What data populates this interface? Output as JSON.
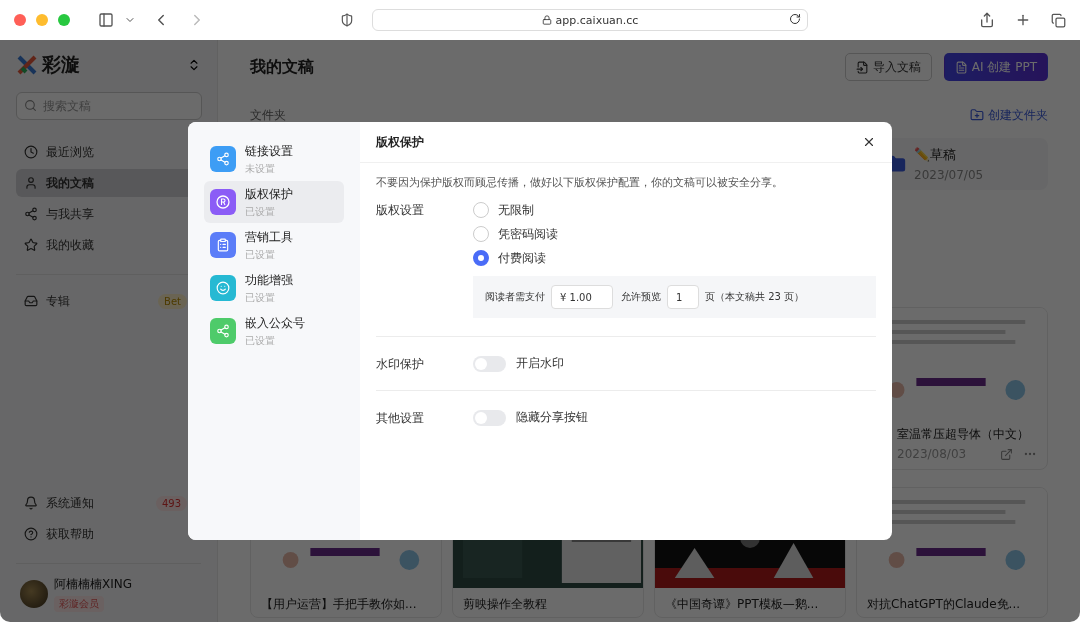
{
  "browser": {
    "url": "app.caixuan.cc"
  },
  "sidebar": {
    "brand": "彩漩",
    "search": {
      "placeholder": "搜索文稿"
    },
    "nav": [
      {
        "label": "最近浏览",
        "kind": "recent",
        "selected": false
      },
      {
        "label": "我的文稿",
        "kind": "mine",
        "selected": true
      },
      {
        "label": "与我共享",
        "kind": "shared",
        "selected": false
      },
      {
        "label": "我的收藏",
        "kind": "favorites",
        "selected": false
      }
    ],
    "album": {
      "label": "专辑",
      "badge": "Bet"
    },
    "footer_items": [
      {
        "label": "系统通知",
        "kind": "notice",
        "badge": "493"
      },
      {
        "label": "获取帮助",
        "kind": "help"
      }
    ],
    "user": {
      "name": "阿楠楠楠XING",
      "membership": "彩漩会员"
    }
  },
  "main": {
    "title": "我的文稿",
    "buttons": [
      {
        "label": "导入文稿",
        "kind": "import"
      },
      {
        "label": "AI 创建 PPT",
        "kind": "ai"
      }
    ],
    "folders_label": "文件夹",
    "create_folder": "创建文件夹",
    "folders": [
      {
        "name": "✏️草稿",
        "date": "2023/07/05"
      }
    ],
    "top_documents": [
      {
        "title": "室温常压超导体（中文）",
        "date": "2023/08/03"
      }
    ],
    "documents": [
      {
        "title": "【用户运营】手把手教你如..."
      },
      {
        "title": "剪映操作全教程"
      },
      {
        "title": "《中国奇谭》PPT模板—鹅..."
      },
      {
        "title": "对抗ChatGPT的Claude免..."
      }
    ]
  },
  "dialog": {
    "nav": [
      {
        "title": "链接设置",
        "status": "未设置",
        "kind": "link",
        "color": "#3d9df5",
        "selected": false
      },
      {
        "title": "版权保护",
        "status": "已设置",
        "kind": "copyright",
        "color": "#8b5cf6",
        "selected": true
      },
      {
        "title": "营销工具",
        "status": "已设置",
        "kind": "marketing",
        "color": "#5b7df8",
        "selected": false
      },
      {
        "title": "功能增强",
        "status": "已设置",
        "kind": "enhance",
        "color": "#26b9d3",
        "selected": false
      },
      {
        "title": "嵌入公众号",
        "status": "已设置",
        "kind": "embed",
        "color": "#4ecb6a",
        "selected": false
      }
    ],
    "title": "版权保护",
    "description": "不要因为保护版权而顾忌传播，做好以下版权保护配置，你的文稿可以被安全分享。",
    "copyright": {
      "label": "版权设置",
      "options": [
        {
          "label": "无限制",
          "selected": false
        },
        {
          "label": "凭密码阅读",
          "selected": false
        },
        {
          "label": "付费阅读",
          "selected": true
        }
      ],
      "pay": {
        "prefix": "阅读者需支付",
        "price": "¥ 1.00",
        "preview_label": "允许预览",
        "preview_pages": "1",
        "suffix": "页（本文稿共 23 页）"
      }
    },
    "toggles": [
      {
        "label": "水印保护",
        "option": "开启水印",
        "on": false
      },
      {
        "label": "其他设置",
        "option": "隐藏分享按钮",
        "on": false
      }
    ]
  }
}
